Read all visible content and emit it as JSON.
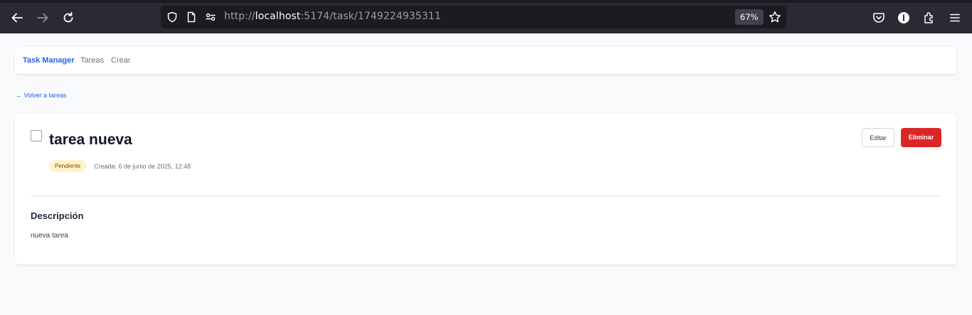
{
  "browser": {
    "url_prefix": "http://",
    "url_host": "localhost",
    "url_rest": ":5174/task/1749224935311",
    "zoom": "67%"
  },
  "navbar": {
    "brand": "Task Manager",
    "links": [
      "Tareas",
      "Crear"
    ]
  },
  "back_link": "← Volver a tareas",
  "task": {
    "title": "tarea nueva",
    "status": "Pendiente",
    "created": "Creada: 6 de junio de 2025, 12:48",
    "edit_label": "Editar",
    "delete_label": "Eliminar",
    "description_heading": "Descripción",
    "description": "nueva tarea"
  },
  "colors": {
    "accent": "#2563eb",
    "danger": "#dc2626",
    "pending_bg": "#fef3c7",
    "pending_text": "#92400e"
  }
}
